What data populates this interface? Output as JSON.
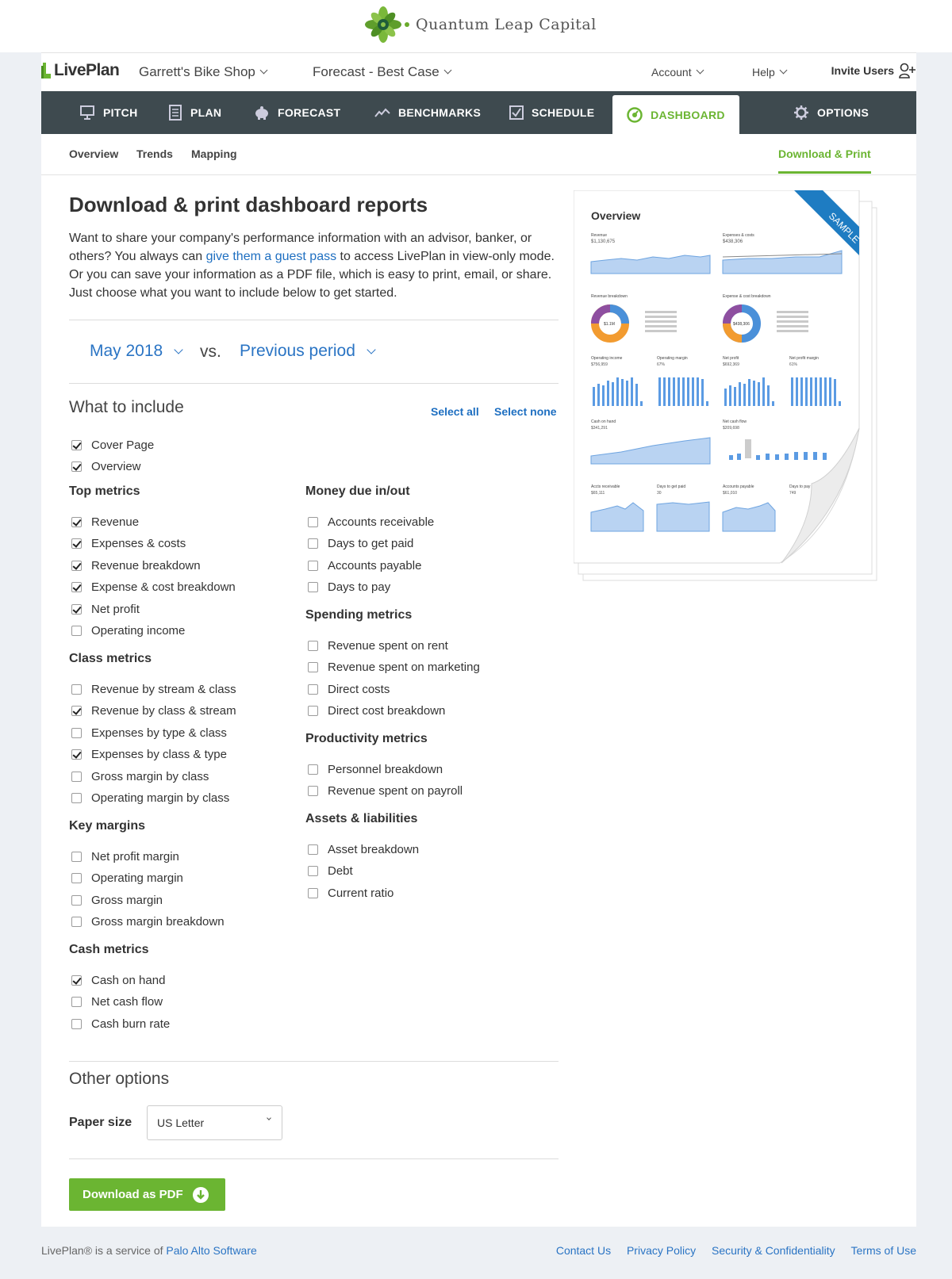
{
  "brand": {
    "name": "Quantum Leap Capital"
  },
  "app": {
    "logo_text": "LivePlan",
    "company": "Garrett's Bike Shop",
    "forecast": "Forecast - Best Case",
    "account": "Account",
    "help": "Help",
    "invite": "Invite Users"
  },
  "nav": {
    "pitch": "PITCH",
    "plan": "PLAN",
    "forecast": "FORECAST",
    "benchmarks": "BENCHMARKS",
    "schedule": "SCHEDULE",
    "dashboard": "DASHBOARD",
    "options": "OPTIONS"
  },
  "subnav": {
    "overview": "Overview",
    "trends": "Trends",
    "mapping": "Mapping",
    "download": "Download & Print"
  },
  "page": {
    "title": "Download & print dashboard reports",
    "intro_1": "Want to share your company's performance information with an advisor, banker, or others? You always can ",
    "intro_link": "give them a guest pass",
    "intro_2": " to access LivePlan in view-only mode. Or you can save your information as a PDF file, which is easy to print, email, or share. Just choose what you want to include below to get started.",
    "period": "May 2018",
    "vs": "vs.",
    "compare": "Previous period",
    "include_title": "What to include",
    "select_all": "Select all",
    "select_none": "Select none",
    "other_title": "Other options",
    "paper_label": "Paper size",
    "paper_value": "US Letter",
    "download_btn": "Download as PDF"
  },
  "top_items": [
    {
      "label": "Cover Page",
      "checked": true
    },
    {
      "label": "Overview",
      "checked": true
    }
  ],
  "groups_left": [
    {
      "title": "Top metrics",
      "items": [
        {
          "label": "Revenue",
          "checked": true
        },
        {
          "label": "Expenses & costs",
          "checked": true
        },
        {
          "label": "Revenue breakdown",
          "checked": true
        },
        {
          "label": "Expense & cost breakdown",
          "checked": true
        },
        {
          "label": "Net profit",
          "checked": true
        },
        {
          "label": "Operating income",
          "checked": false
        }
      ]
    },
    {
      "title": "Class metrics",
      "items": [
        {
          "label": "Revenue by stream & class",
          "checked": false
        },
        {
          "label": "Revenue by class & stream",
          "checked": true
        },
        {
          "label": "Expenses by type & class",
          "checked": false
        },
        {
          "label": "Expenses by class & type",
          "checked": true
        },
        {
          "label": "Gross margin by class",
          "checked": false
        },
        {
          "label": "Operating margin by class",
          "checked": false
        }
      ]
    },
    {
      "title": "Key margins",
      "items": [
        {
          "label": "Net profit margin",
          "checked": false
        },
        {
          "label": "Operating margin",
          "checked": false
        },
        {
          "label": "Gross margin",
          "checked": false
        },
        {
          "label": "Gross margin breakdown",
          "checked": false
        }
      ]
    },
    {
      "title": "Cash metrics",
      "items": [
        {
          "label": "Cash on hand",
          "checked": true
        },
        {
          "label": "Net cash flow",
          "checked": false
        },
        {
          "label": "Cash burn rate",
          "checked": false
        }
      ]
    }
  ],
  "groups_right": [
    {
      "title": "Money due in/out",
      "items": [
        {
          "label": "Accounts receivable",
          "checked": false
        },
        {
          "label": "Days to get paid",
          "checked": false
        },
        {
          "label": "Accounts payable",
          "checked": false
        },
        {
          "label": "Days to pay",
          "checked": false
        }
      ]
    },
    {
      "title": "Spending metrics",
      "items": [
        {
          "label": "Revenue spent on rent",
          "checked": false
        },
        {
          "label": "Revenue spent on marketing",
          "checked": false
        },
        {
          "label": "Direct costs",
          "checked": false
        },
        {
          "label": "Direct cost breakdown",
          "checked": false
        }
      ]
    },
    {
      "title": "Productivity metrics",
      "items": [
        {
          "label": "Personnel breakdown",
          "checked": false
        },
        {
          "label": "Revenue spent on payroll",
          "checked": false
        }
      ]
    },
    {
      "title": "Assets & liabilities",
      "items": [
        {
          "label": "Asset breakdown",
          "checked": false
        },
        {
          "label": "Debt",
          "checked": false
        },
        {
          "label": "Current ratio",
          "checked": false
        }
      ]
    }
  ],
  "sample": {
    "title": "Overview",
    "ribbon": "SAMPLE",
    "revenue_label": "Revenue",
    "revenue_value": "$1,130,675",
    "expenses_label": "Expenses & costs",
    "expenses_value": "$438,306",
    "rev_breakdown": "Revenue breakdown",
    "exp_breakdown": "Expense & cost breakdown",
    "donut1_value": "$1.1M",
    "donut2_value": "$438,306",
    "op_income": "Operating income",
    "op_income_value": "$756,959",
    "op_margin": "Operating margin",
    "op_margin_value": "67%",
    "net_profit": "Net profit",
    "net_profit_value": "$692,369",
    "net_margin": "Net profit margin",
    "net_margin_value": "61%",
    "cash_on_hand": "Cash on hand",
    "cash_value": "$341,291",
    "net_cash_flow": "Net cash flow",
    "net_cash_value": "$209,698",
    "ar": "Accts receivable",
    "ar_value": "$65,111",
    "dtgp": "Days to get paid",
    "dtgp_value": "30",
    "ap": "Accounts payable",
    "ap_value": "$61,010",
    "dtp": "Days to pay",
    "dtp_value": "749"
  },
  "footer": {
    "text": "LivePlan® is a service of ",
    "company_link": "Palo Alto Software",
    "contact": "Contact Us",
    "privacy": "Privacy Policy",
    "security": "Security & Confidentiality",
    "terms": "Terms of Use"
  },
  "colors": {
    "accent_green": "#6bb532",
    "nav_dark": "#3e4a4f",
    "link_blue": "#2a74c4",
    "sample_ribbon": "#1e7cc2"
  }
}
